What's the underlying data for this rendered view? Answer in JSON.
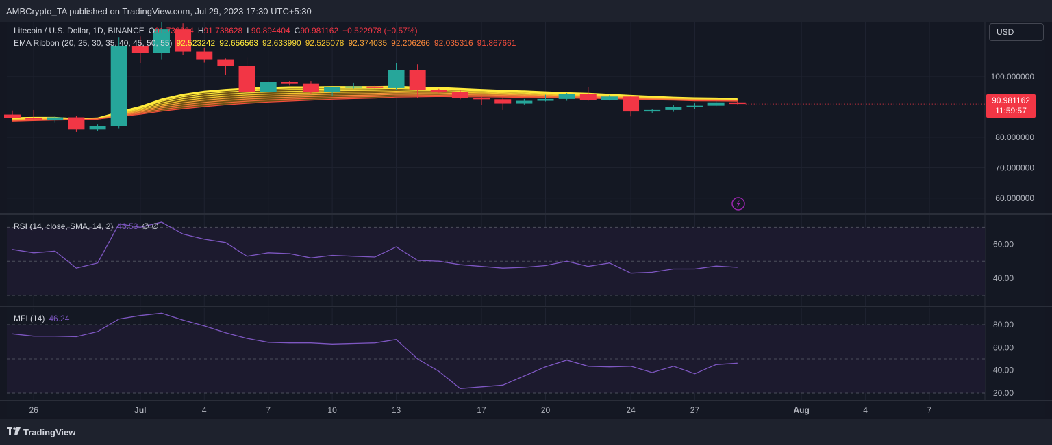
{
  "header": {
    "publisher_line": "AMBCrypto_TA published on TradingView.com, Jul 29, 2023 17:30 UTC+5:30"
  },
  "legend_main": {
    "symbol": "Litecoin / U.S. Dollar, 1D, BINANCE",
    "open_label": "O",
    "open_value": "91.738284",
    "high_label": "H",
    "high_value": "91.738628",
    "low_label": "L",
    "low_value": "90.894404",
    "close_label": "C",
    "close_value": "90.981162",
    "change": "−0.522978 (−0.57%)"
  },
  "legend_ema": {
    "name": "EMA Ribbon (20, 25, 30, 35, 40, 45, 50, 55)",
    "values": [
      "92.523242",
      "92.656563",
      "92.633990",
      "92.525078",
      "92.374035",
      "92.206266",
      "92.035316",
      "91.867661"
    ],
    "value_colors": [
      "#ffeb3b",
      "#ffeb3b",
      "#f6d93a",
      "#f6c52e",
      "#f7a33a",
      "#f5853a",
      "#f36a3a",
      "#f44c3c"
    ]
  },
  "legend_rsi": {
    "name": "RSI (14, close, SMA, 14, 2)",
    "value": "46.53",
    "extra": "∅  ∅"
  },
  "legend_mfi": {
    "name": "MFI (14)",
    "value": "46.24"
  },
  "currency_button": "USD",
  "price_badge": {
    "price": "90.981162",
    "countdown": "11:59:57"
  },
  "footer": {
    "brand": "TradingView"
  },
  "colors": {
    "up": "#26a69a",
    "down": "#f23645",
    "rsi_line": "#7e57c2",
    "background": "#141823"
  },
  "icons": [
    "lightning-icon",
    "tradingview-logo-icon"
  ],
  "chart_data": [
    {
      "type": "candlestick",
      "title": "Litecoin / U.S. Dollar, 1D, BINANCE",
      "x_tick_labels": [
        "26",
        "Jul",
        "4",
        "7",
        "10",
        "13",
        "17",
        "20",
        "24",
        "27",
        "Aug",
        "4",
        "7"
      ],
      "y_tick_labels": [
        "100.000000",
        "80.000000",
        "70.000000",
        "60.000000"
      ],
      "ylim": [
        55,
        118
      ],
      "candles": [
        {
          "date": "2023-06-25",
          "o": 87.5,
          "h": 88.8,
          "l": 86.3,
          "c": 86.5
        },
        {
          "date": "2023-06-26",
          "o": 86.5,
          "h": 89.0,
          "l": 85.6,
          "c": 85.9
        },
        {
          "date": "2023-06-27",
          "o": 85.8,
          "h": 86.9,
          "l": 84.8,
          "c": 86.6
        },
        {
          "date": "2023-06-28",
          "o": 86.6,
          "h": 87.1,
          "l": 81.8,
          "c": 82.6
        },
        {
          "date": "2023-06-29",
          "o": 82.6,
          "h": 84.2,
          "l": 82.1,
          "c": 83.6
        },
        {
          "date": "2023-06-30",
          "o": 83.6,
          "h": 113.0,
          "l": 83.0,
          "c": 110.0
        },
        {
          "date": "2023-07-01",
          "o": 110.0,
          "h": 113.2,
          "l": 104.5,
          "c": 107.8
        },
        {
          "date": "2023-07-02",
          "o": 107.8,
          "h": 118.0,
          "l": 105.5,
          "c": 115.5
        },
        {
          "date": "2023-07-03",
          "o": 115.5,
          "h": 117.5,
          "l": 107.0,
          "c": 108.2
        },
        {
          "date": "2023-07-04",
          "o": 108.2,
          "h": 109.5,
          "l": 104.6,
          "c": 105.5
        },
        {
          "date": "2023-07-05",
          "o": 105.5,
          "h": 106.0,
          "l": 100.5,
          "c": 103.6
        },
        {
          "date": "2023-07-06",
          "o": 103.6,
          "h": 106.2,
          "l": 93.3,
          "c": 95.0
        },
        {
          "date": "2023-07-07",
          "o": 95.0,
          "h": 98.3,
          "l": 94.6,
          "c": 98.2
        },
        {
          "date": "2023-07-08",
          "o": 98.2,
          "h": 98.6,
          "l": 97.0,
          "c": 97.6
        },
        {
          "date": "2023-07-09",
          "o": 97.6,
          "h": 98.4,
          "l": 94.4,
          "c": 95.0
        },
        {
          "date": "2023-07-10",
          "o": 95.0,
          "h": 96.5,
          "l": 93.7,
          "c": 96.5
        },
        {
          "date": "2023-07-11",
          "o": 96.3,
          "h": 98.0,
          "l": 96.0,
          "c": 96.7
        },
        {
          "date": "2023-07-12",
          "o": 96.7,
          "h": 97.0,
          "l": 95.8,
          "c": 96.2
        },
        {
          "date": "2023-07-13",
          "o": 96.2,
          "h": 104.5,
          "l": 95.7,
          "c": 102.2
        },
        {
          "date": "2023-07-14",
          "o": 102.2,
          "h": 104.0,
          "l": 93.0,
          "c": 95.5
        },
        {
          "date": "2023-07-15",
          "o": 95.5,
          "h": 96.0,
          "l": 94.6,
          "c": 94.9
        },
        {
          "date": "2023-07-16",
          "o": 94.9,
          "h": 95.5,
          "l": 92.5,
          "c": 93.0
        },
        {
          "date": "2023-07-17",
          "o": 93.0,
          "h": 93.5,
          "l": 90.7,
          "c": 92.5
        },
        {
          "date": "2023-07-18",
          "o": 92.5,
          "h": 93.5,
          "l": 89.0,
          "c": 91.1
        },
        {
          "date": "2023-07-19",
          "o": 91.1,
          "h": 92.6,
          "l": 90.8,
          "c": 92.0
        },
        {
          "date": "2023-07-20",
          "o": 92.0,
          "h": 94.0,
          "l": 91.8,
          "c": 92.6
        },
        {
          "date": "2023-07-21",
          "o": 92.6,
          "h": 94.6,
          "l": 92.0,
          "c": 94.2
        },
        {
          "date": "2023-07-22",
          "o": 94.2,
          "h": 96.6,
          "l": 92.0,
          "c": 92.3
        },
        {
          "date": "2023-07-23",
          "o": 92.3,
          "h": 93.9,
          "l": 92.1,
          "c": 93.4
        },
        {
          "date": "2023-07-24",
          "o": 93.4,
          "h": 93.6,
          "l": 86.9,
          "c": 88.5
        },
        {
          "date": "2023-07-25",
          "o": 88.5,
          "h": 89.3,
          "l": 88.0,
          "c": 89.0
        },
        {
          "date": "2023-07-26",
          "o": 89.0,
          "h": 90.7,
          "l": 88.4,
          "c": 90.0
        },
        {
          "date": "2023-07-27",
          "o": 90.0,
          "h": 91.2,
          "l": 89.4,
          "c": 90.4
        },
        {
          "date": "2023-07-28",
          "o": 90.4,
          "h": 92.0,
          "l": 90.2,
          "c": 91.5
        },
        {
          "date": "2023-07-29",
          "o": 91.5,
          "h": 91.74,
          "l": 90.89,
          "c": 90.98
        }
      ],
      "ema_ribbon": {
        "periods": [
          20,
          25,
          30,
          35,
          40,
          45,
          50,
          55
        ],
        "last_values": [
          92.523242,
          92.656563,
          92.63399,
          92.525078,
          92.374035,
          92.206266,
          92.035316,
          91.867661
        ],
        "fast_line": [
          86.3,
          86.4,
          86.4,
          86.0,
          86.2,
          88.2,
          90.0,
          92.4,
          94.0,
          95.0,
          95.6,
          96.0,
          96.2,
          96.4,
          96.4,
          96.5,
          96.5,
          96.5,
          96.6,
          96.3,
          96.2,
          95.9,
          95.6,
          95.3,
          95.1,
          94.8,
          94.5,
          94.3,
          94.0,
          93.6,
          93.3,
          93.0,
          92.8,
          92.7,
          92.5
        ],
        "slow_line": [
          85.3,
          85.5,
          85.7,
          85.8,
          86.0,
          86.8,
          87.6,
          88.6,
          89.4,
          90.1,
          90.7,
          91.2,
          91.6,
          91.9,
          92.2,
          92.5,
          92.7,
          92.9,
          93.2,
          93.3,
          93.4,
          93.3,
          93.3,
          93.2,
          93.1,
          93.0,
          92.9,
          92.8,
          92.7,
          92.5,
          92.3,
          92.2,
          92.0,
          91.95,
          91.87
        ]
      },
      "last_price": 90.981162
    },
    {
      "type": "line",
      "title": "RSI (14, close, SMA, 14, 2)",
      "y_tick_labels": [
        "60.00",
        "40.00"
      ],
      "ylim": [
        24,
        77
      ],
      "reference_levels": [
        70,
        50,
        30
      ],
      "x": [
        "2023-06-25",
        "2023-06-26",
        "2023-06-27",
        "2023-06-28",
        "2023-06-29",
        "2023-06-30",
        "2023-07-01",
        "2023-07-02",
        "2023-07-03",
        "2023-07-04",
        "2023-07-05",
        "2023-07-06",
        "2023-07-07",
        "2023-07-08",
        "2023-07-09",
        "2023-07-10",
        "2023-07-11",
        "2023-07-12",
        "2023-07-13",
        "2023-07-14",
        "2023-07-15",
        "2023-07-16",
        "2023-07-17",
        "2023-07-18",
        "2023-07-19",
        "2023-07-20",
        "2023-07-21",
        "2023-07-22",
        "2023-07-23",
        "2023-07-24",
        "2023-07-25",
        "2023-07-26",
        "2023-07-27",
        "2023-07-28",
        "2023-07-29"
      ],
      "series": [
        {
          "values": [
            57,
            55,
            56,
            46,
            49,
            72,
            70,
            73,
            66,
            63,
            61,
            53,
            55,
            54.5,
            52,
            53.5,
            53,
            52.5,
            58.5,
            50.5,
            50,
            48,
            47,
            46,
            46.5,
            47.5,
            50,
            47,
            49,
            43,
            43.5,
            45.5,
            45.5,
            47.2,
            46.5
          ]
        }
      ]
    },
    {
      "type": "line",
      "title": "MFI (14)",
      "y_tick_labels": [
        "80.00",
        "60.00",
        "40.00",
        "20.00"
      ],
      "ylim": [
        14,
        95
      ],
      "reference_levels": [
        80,
        50,
        20
      ],
      "x": [
        "2023-06-25",
        "2023-06-26",
        "2023-06-27",
        "2023-06-28",
        "2023-06-29",
        "2023-06-30",
        "2023-07-01",
        "2023-07-02",
        "2023-07-03",
        "2023-07-04",
        "2023-07-05",
        "2023-07-06",
        "2023-07-07",
        "2023-07-08",
        "2023-07-09",
        "2023-07-10",
        "2023-07-11",
        "2023-07-12",
        "2023-07-13",
        "2023-07-14",
        "2023-07-15",
        "2023-07-16",
        "2023-07-17",
        "2023-07-18",
        "2023-07-19",
        "2023-07-20",
        "2023-07-21",
        "2023-07-22",
        "2023-07-23",
        "2023-07-24",
        "2023-07-25",
        "2023-07-26",
        "2023-07-27",
        "2023-07-28",
        "2023-07-29"
      ],
      "series": [
        {
          "values": [
            72,
            70,
            70,
            69.5,
            74,
            85,
            88,
            90,
            84,
            79,
            73,
            68,
            64.5,
            64,
            64,
            63,
            63.5,
            64,
            67,
            50,
            39,
            24,
            25.5,
            27,
            35,
            43,
            49,
            43.5,
            43,
            43.5,
            38,
            43.5,
            37,
            45,
            46.2
          ]
        }
      ]
    }
  ]
}
